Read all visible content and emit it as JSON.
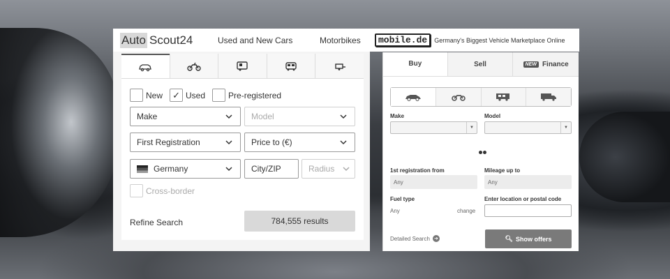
{
  "autoscout": {
    "logo_auto": "Auto",
    "logo_scout": "Scout24",
    "nav_used_new": "Used and New Cars",
    "nav_motorbikes": "Motorbikes",
    "tabs": [
      "car-icon",
      "motorbike-icon",
      "caravan-icon",
      "van-icon",
      "trailer-icon"
    ],
    "checkbox_new": "New",
    "checkbox_used": "Used",
    "checkbox_used_checked": true,
    "checkbox_preregistered": "Pre-registered",
    "make": "Make",
    "model": "Model",
    "first_registration": "First Registration",
    "price_to": "Price to (€)",
    "country": "Germany",
    "city_zip": "City/ZIP",
    "radius": "Radius",
    "cross_border": "Cross-border",
    "refine_search": "Refine Search",
    "results": "784,555 results"
  },
  "mobile": {
    "logo": "mobile.de",
    "tagline": "Germany's Biggest Vehicle Marketplace Online",
    "tab_buy": "Buy",
    "tab_sell": "Sell",
    "tab_new_badge": "NEW",
    "tab_finance": "Finance",
    "vehicle_types": [
      "car-icon",
      "motorbike-icon",
      "motorhome-icon",
      "truck-icon"
    ],
    "make_label": "Make",
    "model_label": "Model",
    "first_reg_label": "1st registration from",
    "first_reg_value": "Any",
    "mileage_label": "Mileage up to",
    "mileage_value": "Any",
    "fuel_label": "Fuel type",
    "fuel_value": "Any",
    "fuel_change": "change",
    "location_label": "Enter location or postal code",
    "detailed_search": "Detailed Search",
    "show_offers": "Show offers"
  },
  "colors": {
    "panel_bg": "#f4f4f4",
    "button_grey": "#d9d9d9",
    "offers_button": "#7a7a7a"
  }
}
